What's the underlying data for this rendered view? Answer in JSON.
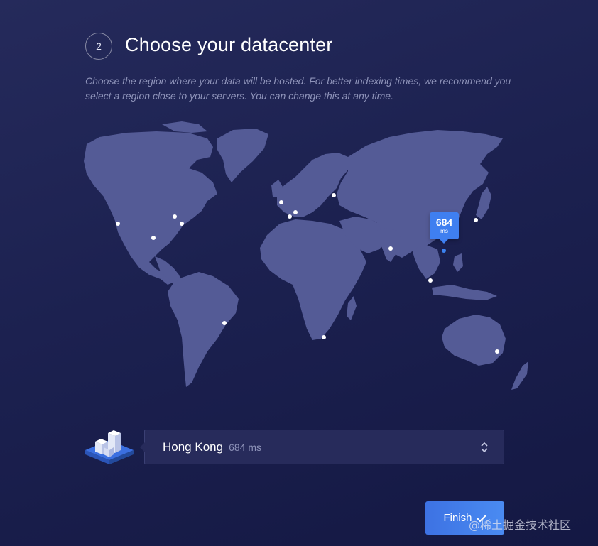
{
  "step": {
    "number": "2",
    "title": "Choose your datacenter"
  },
  "description": "Choose the region where your data will be hosted. For better indexing times, we recommend you select a region close to your servers. You can change this at any time.",
  "map": {
    "icon": "world-map",
    "selected_region_latency": {
      "value": "684",
      "unit": "ms"
    }
  },
  "datacenter_select": {
    "icon": "datacenter-buildings-icon",
    "selected_name": "Hong Kong",
    "selected_latency": "684 ms",
    "toggle_icon": "up-down-chevron-icon"
  },
  "finish_button": {
    "label": "Finish",
    "icon": "checkmark-icon"
  },
  "watermark": "@稀土掘金技术社区",
  "colors": {
    "background": "#1c2150",
    "land": "#545b96",
    "accent": "#3f7ff0"
  }
}
